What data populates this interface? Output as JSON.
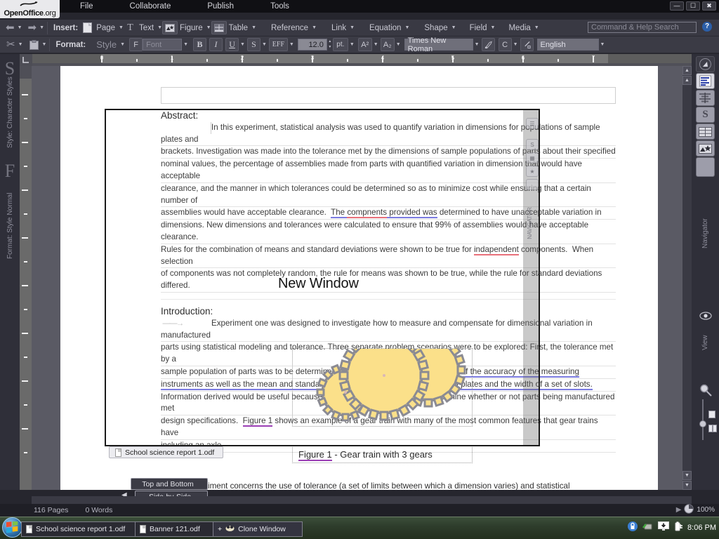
{
  "titlebar": {
    "brand_main": "OpenOffice",
    "brand_suffix": ".org",
    "menus": [
      "File",
      "Collaborate",
      "Publish",
      "Tools"
    ],
    "window_buttons": {
      "minimize": "—",
      "maximize": "☐",
      "close": "✖"
    }
  },
  "toolbar_insert": {
    "label": "Insert:",
    "back_icon": "back-arrow-icon",
    "forward_icon": "forward-arrow-icon",
    "items": [
      {
        "label": "Page",
        "icon": "page-icon"
      },
      {
        "label": "Text",
        "icon": "text-icon"
      },
      {
        "label": "Figure",
        "icon": "figure-icon"
      },
      {
        "label": "Table",
        "icon": "table-icon"
      },
      {
        "label": "Reference",
        "icon": ""
      },
      {
        "label": "Link",
        "icon": ""
      },
      {
        "label": "Equation",
        "icon": ""
      },
      {
        "label": "Shape",
        "icon": ""
      },
      {
        "label": "Field",
        "icon": ""
      },
      {
        "label": "Media",
        "icon": ""
      }
    ]
  },
  "toolbar_format": {
    "label": "Format:",
    "cut_icon": "scissors-icon",
    "paste_icon": "clipboard-icon",
    "style_label": "Style",
    "font_glyph": "F",
    "font_placeholder": "Font",
    "bold": "B",
    "italic": "I",
    "underline": "U",
    "strikethrough": "S",
    "effects": "EFF",
    "font_size": "12.0",
    "font_unit": "pt.",
    "superscript": "A²",
    "subscript": "A₂",
    "font_name": "Times New Roman",
    "highlight_icon": "highlight-pen-icon",
    "char_color": "C",
    "fill_icon": "fill-color-icon",
    "language": "English"
  },
  "search": {
    "placeholder": "Command & Help Search",
    "help_glyph": "?"
  },
  "left_rail": {
    "group1_glyph": "S",
    "group1_label": "Style: Character Styles",
    "group2_glyph": "F",
    "group2_label": "Format: Style Normal"
  },
  "right_rail": {
    "icons": [
      "compass-icon",
      "paragraph-document-icon",
      "align-icon",
      "style-s-icon",
      "table-icon",
      "figure-icon",
      "blank-panel-icon"
    ],
    "navigator_label": "Navigator",
    "view_label": "View",
    "view_icon": "eye-icon",
    "zoom_icon": "magnifier-icon",
    "zoom_page_icon": "single-page-icon",
    "zoom_multipage_icon": "multi-page-icon"
  },
  "ruler": {
    "ticks": [
      "0",
      "1",
      "2",
      "3",
      "4",
      "5",
      "6",
      "7",
      "8"
    ]
  },
  "document": {
    "abstract_heading": "Abstract:",
    "abstract_lines": [
      "In this experiment, statistical analysis was used to quantify variation in dimensions for populations of sample plates and",
      "brackets.  Investigation was made into the tolerance met by the dimensions of sample populations of parts about their specified",
      "nominal values, the percentage of assemblies made from parts with quantified variation in dimension that would have acceptable",
      "clearance, and the manner in which tolerances could be determined so as to minimize cost while ensuring that a certain number of",
      "assemblies would have acceptable clearance.  The compnents provided was determined to have unacceptable variation in",
      "dimensions.  New dimensions and tolerances were calculated to ensure that 99% of assemblies would have acceptable clearance.",
      "Rules for the combination of means and standard deviations were shown to be true for indapendent components.  When selection",
      "of components was not completely random, the rule for means was shown to be true, while the rule for standard deviations differed."
    ],
    "intro_heading": "Introduction:",
    "intro_lines": [
      "Experiment one was designed to investigate how to measure and compensate for dimensional variation in manufactured",
      "parts using statistical modeling and tolerance.  Three separate problem scenarios were to be explored:  First, the tolerance met by a",
      "sample population of parts was to be determined.  The others involve determination of the accuracy of the measuring",
      "instruments as well as the mean and standard deviation of the thickness of a set of plates and the width of a set of slots.",
      "Information derived would be useful because it would allow an engineer to determine whether or not parts being manufactured met",
      "design specifications.  Figure 1 shows an example of a gear train with many of the most common features that gear trains have",
      "including an axle."
    ],
    "misspelled_words": [
      "compnents",
      "indapendent"
    ],
    "cross_reference": "Figure 1",
    "figure_caption_prefix": "Figure 1",
    "figure_caption_rest": " - Gear train with 3 gears",
    "figure_alt": "gear-train-with-3-gears",
    "gear_color": "#FBE08A",
    "gear_outline": "#8b8b93",
    "footer_line": "for this experiment concerns the use of tolerance (a set of limits between which a dimension varies) and statistical"
  },
  "overlay": {
    "drag_label": "New Window",
    "panel_icons": [
      "paragraph-icon",
      "style-s-icon",
      "table-icon",
      "figure-icon",
      "blank-icon"
    ],
    "panel_label": "NAVIGATOR"
  },
  "floating_tabs": {
    "doc_tab": "School science report 1.odf",
    "wrap_top_bottom": "Top and Bottom",
    "wrap_side_by_side": "Side-by-Side"
  },
  "statusbar": {
    "pages": "116 Pages",
    "words": "0 Words",
    "zoom_level": "100%",
    "zoom_play_icon": "play-icon",
    "zoom_pie_icon": "zoom-pie-icon"
  },
  "taskbar": {
    "start_icon": "windows-start-orb",
    "quicklaunch": [
      "show-desktop-icon",
      "internet-explorer-icon",
      "switch-windows-icon"
    ],
    "items": [
      {
        "label": "School science report 1.odf",
        "icon": "document-icon"
      },
      {
        "label": "Banner 121.odf",
        "icon": "document-icon"
      },
      {
        "label": "Clone Window",
        "icon": "clone-window-icon",
        "prefix": "+"
      }
    ],
    "tray": {
      "icons": [
        "security-lock-icon",
        "network-plug-icon",
        "monitor-download-icon",
        "battery-icon"
      ],
      "clock": "8:06 PM"
    }
  }
}
